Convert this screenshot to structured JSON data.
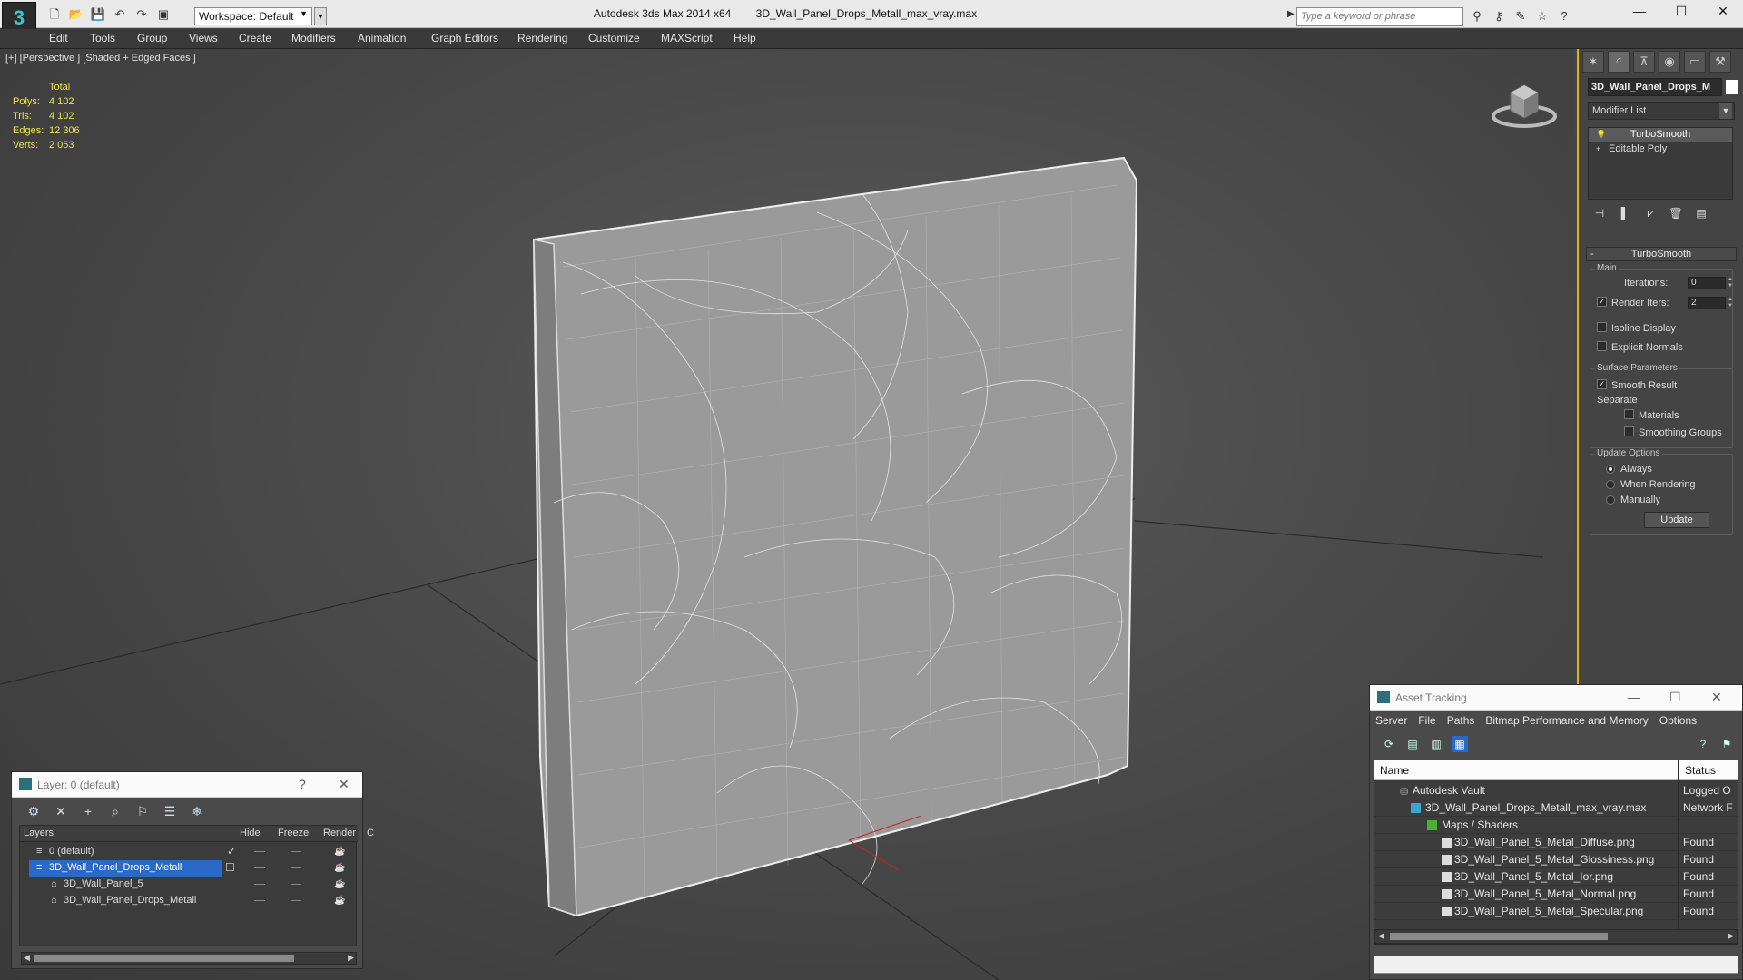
{
  "app": {
    "title": "Autodesk 3ds Max  2014 x64",
    "file": "3D_Wall_Panel_Drops_Metall_max_vray.max",
    "workspace": "Workspace: Default",
    "search_placeholder": "Type a keyword or phrase",
    "window_controls": [
      "—",
      "☐",
      "✕"
    ]
  },
  "menu": [
    "Edit",
    "Tools",
    "Group",
    "Views",
    "Create",
    "Modifiers",
    "Animation",
    "Graph Editors",
    "Rendering",
    "Customize",
    "MAXScript",
    "Help"
  ],
  "viewport": {
    "label": "[+] [Perspective ] [Shaded + Edged Faces ]",
    "stats": {
      "header": "Total",
      "rows": [
        {
          "k": "Polys:",
          "v": "4 102"
        },
        {
          "k": "Tris:",
          "v": "4 102"
        },
        {
          "k": "Edges:",
          "v": "12 306"
        },
        {
          "k": "Verts:",
          "v": "2 053"
        }
      ]
    }
  },
  "command_panel": {
    "object_name": "3D_Wall_Panel_Drops_M",
    "modifier_list": "Modifier List",
    "stack": [
      "TurboSmooth",
      "Editable Poly"
    ],
    "rollout": {
      "title": "TurboSmooth",
      "main_group": "Main",
      "iterations_label": "Iterations:",
      "iterations_value": "0",
      "render_iters_label": "Render Iters:",
      "render_iters_value": "2",
      "isoline": "Isoline Display",
      "explicit": "Explicit Normals",
      "surface_group": "Surface Parameters",
      "smooth_result": "Smooth Result",
      "separate": "Separate",
      "materials": "Materials",
      "smoothing_groups": "Smoothing Groups",
      "update_group": "Update Options",
      "always": "Always",
      "when_rendering": "When Rendering",
      "manually": "Manually",
      "update_button": "Update"
    }
  },
  "layer_dialog": {
    "title": "Layer: 0 (default)",
    "help": "?",
    "close": "✕",
    "columns": [
      "Layers",
      "Hide",
      "Freeze",
      "Render",
      "C"
    ],
    "rows": [
      {
        "name": "0 (default)",
        "indent": 0
      },
      {
        "name": "3D_Wall_Panel_Drops_Metall",
        "indent": 0
      },
      {
        "name": "3D_Wall_Panel_5",
        "indent": 1
      },
      {
        "name": "3D_Wall_Panel_Drops_Metall",
        "indent": 1
      }
    ]
  },
  "asset_dialog": {
    "title": "Asset Tracking",
    "menu": [
      "Server",
      "File",
      "Paths",
      "Bitmap Performance and Memory",
      "Options"
    ],
    "columns": [
      "Name",
      "Status"
    ],
    "rows": [
      {
        "name": "Autodesk Vault",
        "status": "Logged O",
        "level": 0
      },
      {
        "name": "3D_Wall_Panel_Drops_Metall_max_vray.max",
        "status": "Network F",
        "level": 1
      },
      {
        "name": "Maps / Shaders",
        "status": "",
        "level": 2
      },
      {
        "name": "3D_Wall_Panel_5_Metal_Diffuse.png",
        "status": "Found",
        "level": 3
      },
      {
        "name": "3D_Wall_Panel_5_Metal_Glossiness.png",
        "status": "Found",
        "level": 3
      },
      {
        "name": "3D_Wall_Panel_5_Metal_Ior.png",
        "status": "Found",
        "level": 3
      },
      {
        "name": "3D_Wall_Panel_5_Metal_Normal.png",
        "status": "Found",
        "level": 3
      },
      {
        "name": "3D_Wall_Panel_5_Metal_Specular.png",
        "status": "Found",
        "level": 3
      }
    ]
  },
  "colors": {
    "accent_blue": "#2a69c7",
    "stats_yellow": "#f2e44c",
    "panel_border": "#d9b31a"
  }
}
